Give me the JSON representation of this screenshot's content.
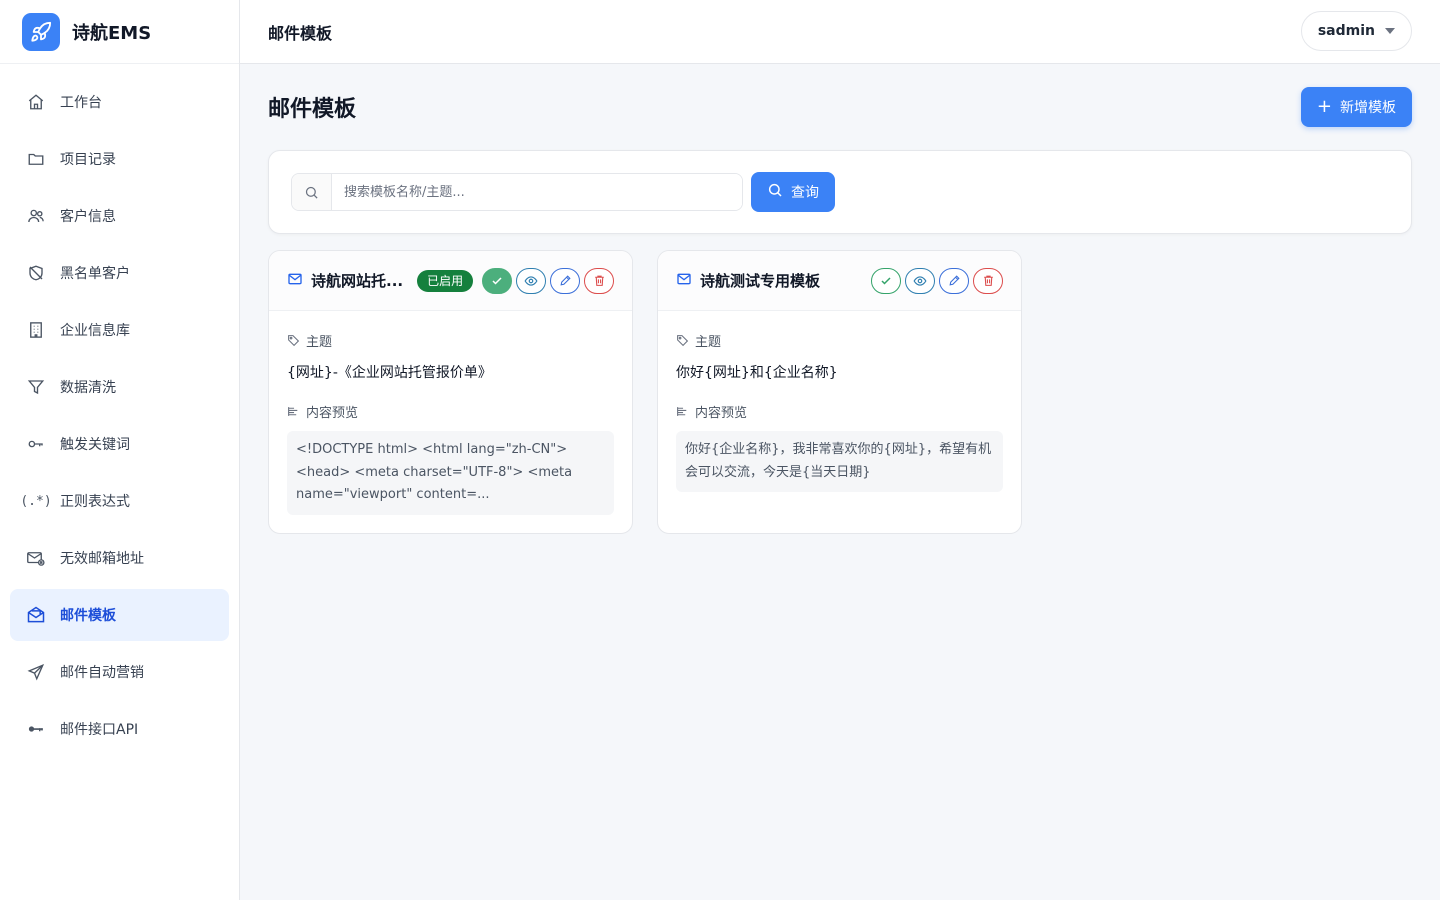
{
  "app": {
    "name": "诗航EMS"
  },
  "header": {
    "title": "邮件模板",
    "user": "sadmin"
  },
  "sidebar": {
    "items": [
      {
        "label": "工作台",
        "icon": "home-icon"
      },
      {
        "label": "项目记录",
        "icon": "folder-icon"
      },
      {
        "label": "客户信息",
        "icon": "users-icon"
      },
      {
        "label": "黑名单客户",
        "icon": "shield-off-icon"
      },
      {
        "label": "企业信息库",
        "icon": "building-icon"
      },
      {
        "label": "数据清洗",
        "icon": "filter-icon"
      },
      {
        "label": "触发关键词",
        "icon": "key-icon"
      },
      {
        "label": "正则表达式",
        "icon": "regex-icon"
      },
      {
        "label": "无效邮箱地址",
        "icon": "mail-x-icon"
      },
      {
        "label": "邮件模板",
        "icon": "mail-open-icon",
        "active": true
      },
      {
        "label": "邮件自动营销",
        "icon": "send-icon"
      },
      {
        "label": "邮件接口API",
        "icon": "api-key-icon"
      }
    ]
  },
  "page": {
    "title": "邮件模板",
    "add_label": "新增模板",
    "search": {
      "placeholder": "搜索模板名称/主题...",
      "button": "查询"
    }
  },
  "labels": {
    "subject": "主题",
    "preview": "内容预览"
  },
  "templates": [
    {
      "name": "诗航网站托...",
      "status": "已启用",
      "subject": "{网址}-《企业网站托管报价单》",
      "preview": "<!DOCTYPE html> <html lang=\"zh-CN\"> <head> <meta charset=\"UTF-8\"> <meta name=\"viewport\" content=..."
    },
    {
      "name": "诗航测试专用模板",
      "status": "",
      "subject": "你好{网址}和{企业名称}",
      "preview": "你好{企业名称}，我非常喜欢你的{网址}，希望有机会可以交流，今天是{当天日期}"
    }
  ],
  "colors": {
    "accent": "#3b82f6",
    "active_bg": "#eaf2ff",
    "enabled_badge": "#15803d",
    "danger": "#dc4c4c"
  }
}
